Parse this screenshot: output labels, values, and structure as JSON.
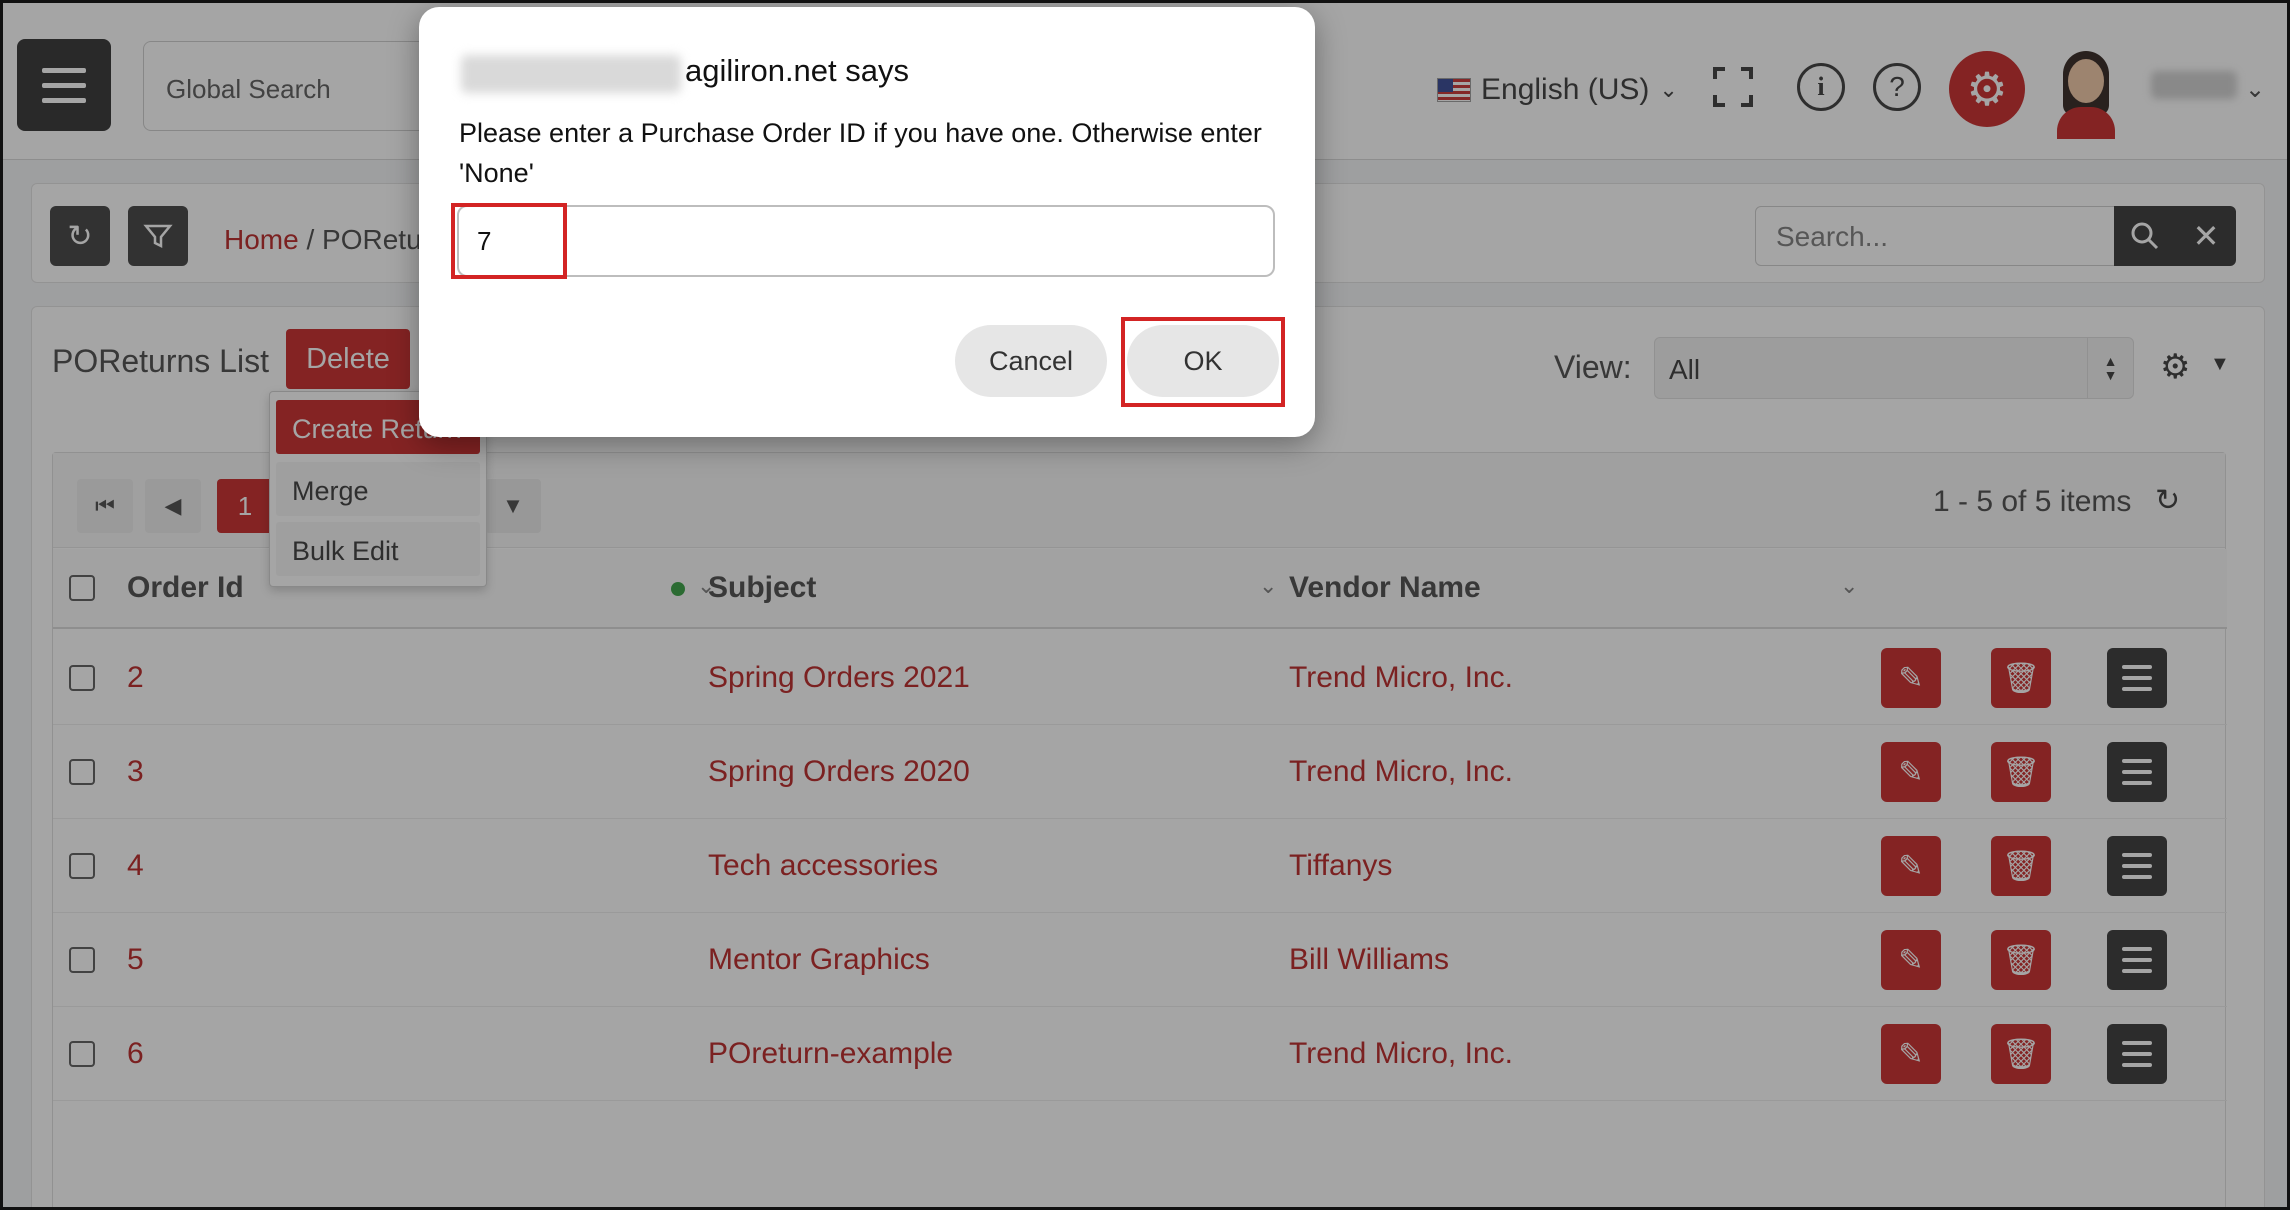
{
  "header": {
    "global_search_placeholder": "Global Search",
    "language": "English (US)"
  },
  "toolbar": {
    "breadcrumb_home": "Home",
    "breadcrumb_sep": "/",
    "breadcrumb_current": "POReturns",
    "search_placeholder": "Search..."
  },
  "list": {
    "title": "POReturns List",
    "delete_label": "Delete",
    "view_label": "View:",
    "view_value": "All",
    "current_page": "1",
    "item_count": "1 - 5 of 5 items",
    "columns": [
      "Order Id",
      "Subject",
      "Vendor Name"
    ],
    "rows": [
      {
        "order_id": "2",
        "subject": "Spring Orders 2021",
        "vendor": "Trend Micro, Inc."
      },
      {
        "order_id": "3",
        "subject": "Spring Orders 2020",
        "vendor": "Trend Micro, Inc."
      },
      {
        "order_id": "4",
        "subject": "Tech accessories",
        "vendor": "Tiffanys"
      },
      {
        "order_id": "5",
        "subject": "Mentor Graphics",
        "vendor": "Bill Williams"
      },
      {
        "order_id": "6",
        "subject": "POreturn-example",
        "vendor": "Trend Micro, Inc."
      }
    ]
  },
  "dropdown": {
    "create": "Create Return",
    "merge": "Merge",
    "bulk_edit": "Bulk Edit"
  },
  "dialog": {
    "title": "agiliron.net says",
    "message": "Please enter a Purchase Order ID if you have one. Otherwise enter 'None'",
    "input_value": "7",
    "cancel_label": "Cancel",
    "ok_label": "OK"
  },
  "colors": {
    "brand_red": "#c62020",
    "highlight_red": "#d32424",
    "dark_button": "#2f2f2f"
  },
  "icons": [
    "hamburger-icon",
    "fullscreen-icon",
    "info-icon",
    "help-icon",
    "gear-icon",
    "refresh-icon",
    "filter-icon",
    "search-icon",
    "close-icon",
    "edit-icon",
    "trash-icon",
    "menu-icon"
  ]
}
